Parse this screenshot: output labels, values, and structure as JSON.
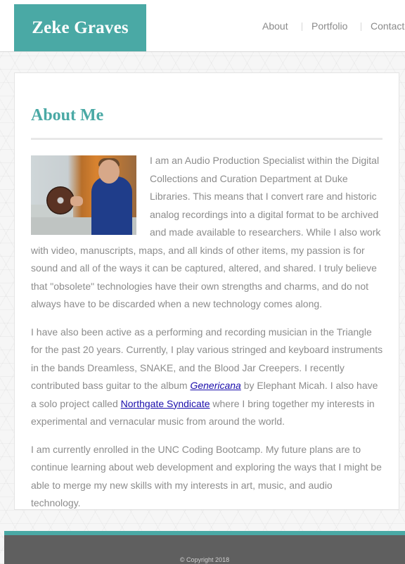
{
  "header": {
    "brand": "Zeke Graves",
    "nav": [
      {
        "label": "About"
      },
      {
        "label": "Portfolio"
      },
      {
        "label": "Contact"
      }
    ]
  },
  "about": {
    "title": "About Me",
    "photo_icon": "profile-photo",
    "p1": "I am an Audio Production Specialist within the Digital Collections and Curation Department at Duke Libraries. This means that I convert rare and historic analog recordings into a digital format to be archived and made available to researchers. While I also work with video, manuscripts, maps, and all kinds of other items, my passion is for sound and all of the ways it can be captured, altered, and shared. I truly believe that \"obsolete\" technologies have their own strengths and charms, and do not always have to be discarded when a new technology comes along.",
    "p2_a": "I have also been active as a performing and recording musician in the Triangle for the past 20 years. Currently, I play various stringed and keyboard instruments in the bands Dreamless, SNAKE, and the Blood Jar Creepers. I recently contributed bass guitar to the album ",
    "p2_link1": "Genericana",
    "p2_b": " by Elephant Micah. I also have a solo project called ",
    "p2_link2": "Northgate Syndicate",
    "p2_c": " where I bring together my interests in experimental and vernacular music from around the world.",
    "p3": "I am currently enrolled in the UNC Coding Bootcamp. My future plans are to continue learning about web development and exploring the ways that I might be able to merge my new skills with my interests in art, music, and audio technology."
  },
  "footer": {
    "copyright": "© Copyright 2018"
  },
  "colors": {
    "accent": "#4aa9a5",
    "footer": "#5f5f5f",
    "link": "#1a0dab"
  }
}
